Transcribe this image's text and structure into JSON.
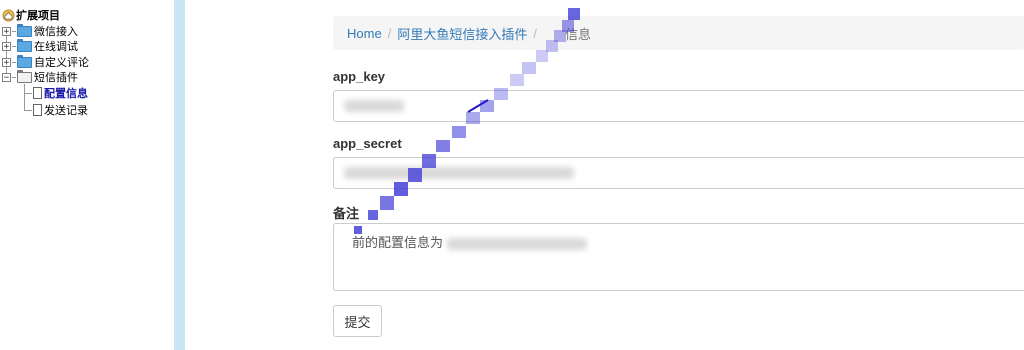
{
  "sidebar": {
    "root_label": "扩展项目",
    "items": [
      {
        "label": "微信接入",
        "expander": "+"
      },
      {
        "label": "在线调试",
        "expander": "+"
      },
      {
        "label": "自定义评论",
        "expander": "+"
      },
      {
        "label": "短信插件",
        "expander": "−"
      }
    ],
    "children": [
      {
        "label": "配置信息",
        "selected": true
      },
      {
        "label": "发送记录",
        "selected": false
      }
    ]
  },
  "breadcrumb": {
    "home": "Home",
    "separator": "/",
    "plugin": "阿里大鱼短信接入插件",
    "current": "信息"
  },
  "form": {
    "app_key_label": "app_key",
    "app_secret_label": "app_secret",
    "remark_label": "备注",
    "remark_text": "前的配置信息为",
    "submit_label": "提交"
  },
  "colors": {
    "divider": "#c9e6f3",
    "link": "#337ab7",
    "selected": "#1a1aa8"
  }
}
